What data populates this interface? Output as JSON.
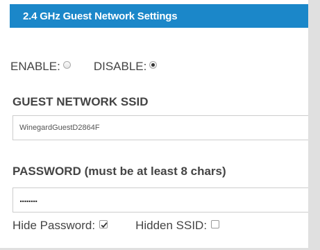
{
  "header": {
    "title": "2.4 GHz Guest Network Settings"
  },
  "enable_row": {
    "enable_label": "ENABLE:",
    "disable_label": "DISABLE:",
    "enable_checked": false,
    "disable_checked": true
  },
  "ssid": {
    "title": "GUEST NETWORK SSID",
    "value": "WinegardGuestD2864F"
  },
  "password": {
    "title": "PASSWORD (must be at least 8 chars)",
    "masked_value": "........"
  },
  "options": {
    "hide_password_label": "Hide Password:",
    "hide_password_checked": true,
    "hidden_ssid_label": "Hidden SSID:",
    "hidden_ssid_checked": false
  },
  "colors": {
    "header_bg": "#1b87c9",
    "panel_bg": "#ffffff",
    "page_bg": "#e0e0e0"
  }
}
